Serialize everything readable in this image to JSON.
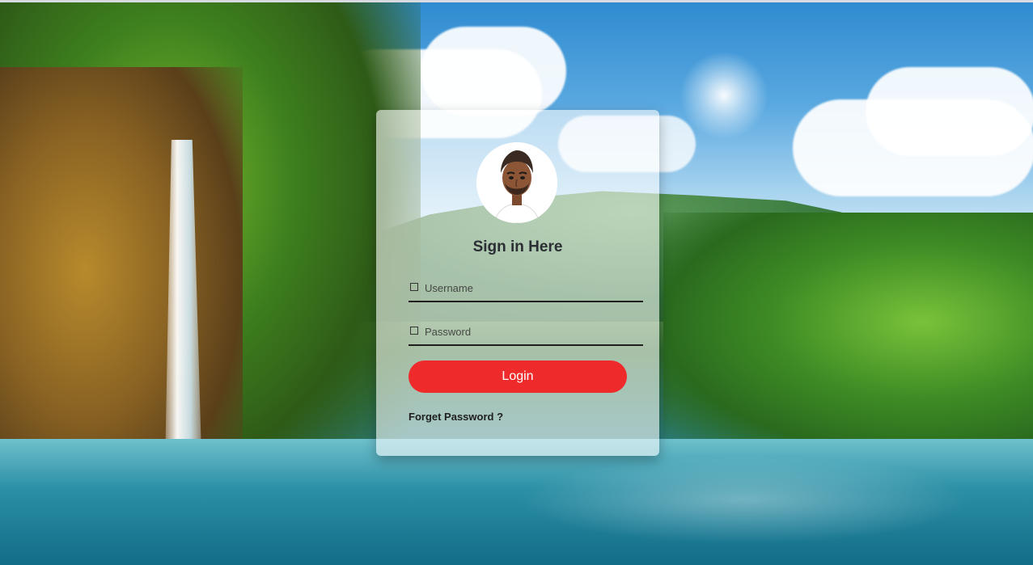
{
  "login": {
    "title": "Sign in Here",
    "username_placeholder": "Username",
    "password_placeholder": "Password",
    "login_label": "Login",
    "forgot_label": "Forget Password ?",
    "username_icon": "user-icon",
    "password_icon": "lock-icon"
  },
  "colors": {
    "button": "#ee2a2a",
    "title": "#2a2d33",
    "card_background": "rgba(255,255,255,0.58)"
  }
}
